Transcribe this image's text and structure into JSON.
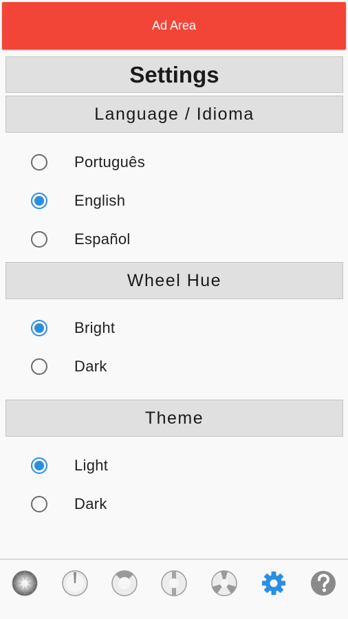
{
  "ad": {
    "label": "Ad Area",
    "color": "#f24537"
  },
  "settings": {
    "title": "Settings"
  },
  "sections": {
    "language": {
      "title": "Language / Idioma",
      "options": [
        {
          "label": "Português",
          "checked": false
        },
        {
          "label": "English",
          "checked": true
        },
        {
          "label": "Español",
          "checked": false
        }
      ]
    },
    "wheel_hue": {
      "title": "Wheel Hue",
      "options": [
        {
          "label": "Bright",
          "checked": true
        },
        {
          "label": "Dark",
          "checked": false
        }
      ]
    },
    "theme": {
      "title": "Theme",
      "options": [
        {
          "label": "Light",
          "checked": true
        },
        {
          "label": "Dark",
          "checked": false
        }
      ]
    }
  },
  "bottom_nav": {
    "items": [
      {
        "icon": "full-wheel-icon",
        "active": false
      },
      {
        "icon": "wheel-needle-up-icon",
        "active": false
      },
      {
        "icon": "wheel-top-sector-icon",
        "active": false
      },
      {
        "icon": "wheel-vertical-split-icon",
        "active": false
      },
      {
        "icon": "wheel-three-sector-icon",
        "active": false
      },
      {
        "icon": "gear-icon",
        "active": true
      },
      {
        "icon": "help-icon",
        "active": false
      }
    ]
  },
  "colors": {
    "accent": "#2a8ee6",
    "header_bg": "#e0e0e0",
    "background": "#f9f9f9"
  }
}
